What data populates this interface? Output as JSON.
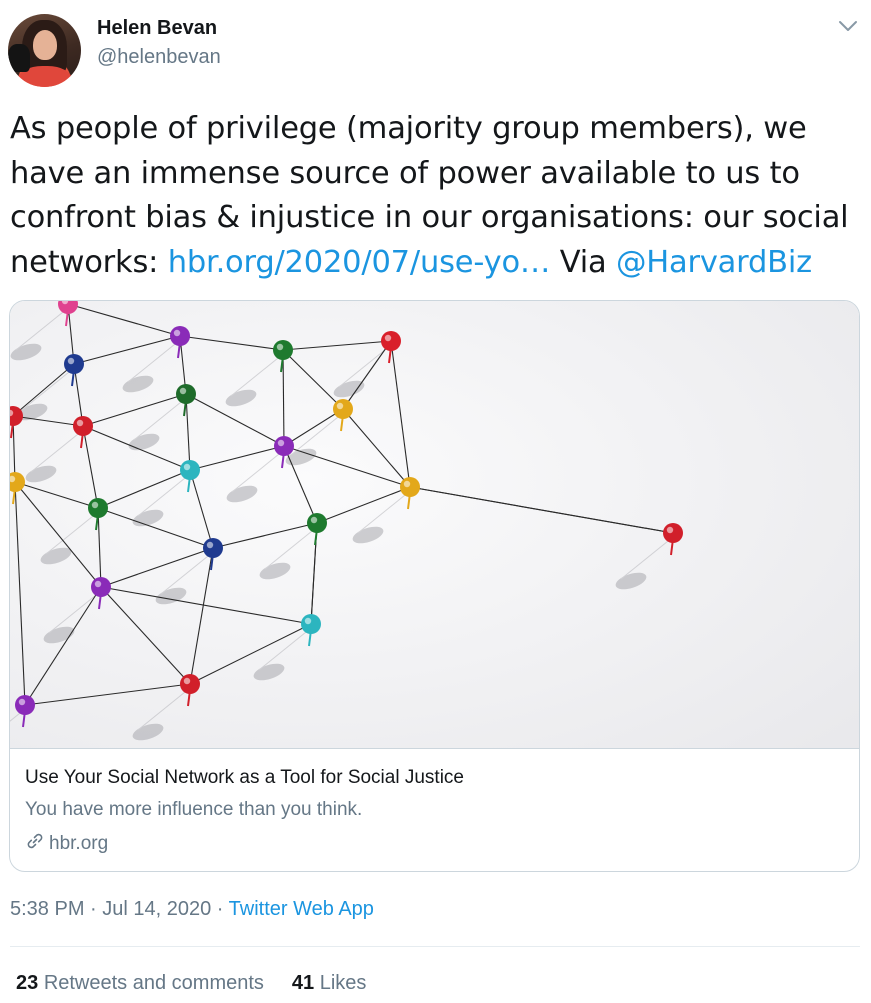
{
  "author": {
    "name": "Helen Bevan",
    "handle": "@helenbevan"
  },
  "tweet": {
    "lines": [
      "As people of privilege (majority group members), we",
      "have an immense source of power available to us to",
      "confront bias & injustice in our organisations: our social"
    ],
    "line4_prefix": "networks: ",
    "link_text": "hbr.org/2020/07/use-yo…",
    "via_text": " Via ",
    "mention": "@HarvardBiz"
  },
  "card": {
    "title": "Use Your Social Network as a Tool for Social Justice",
    "description": "You have more influence than you think.",
    "domain": "hbr.org"
  },
  "meta": {
    "time": "5:38 PM",
    "separator": " · ",
    "date": "Jul 14, 2020",
    "source": "Twitter Web App"
  },
  "stats": {
    "retweets_count": "23",
    "retweets_label": "Retweets and comments",
    "likes_count": "41",
    "likes_label": "Likes"
  },
  "colors": {
    "link": "#1b95e0",
    "secondary_text": "#657786",
    "primary_text": "#14171a",
    "border": "#ccd6dd"
  },
  "icons": {
    "caret": "chevron-down-icon",
    "domain": "link-icon"
  }
}
